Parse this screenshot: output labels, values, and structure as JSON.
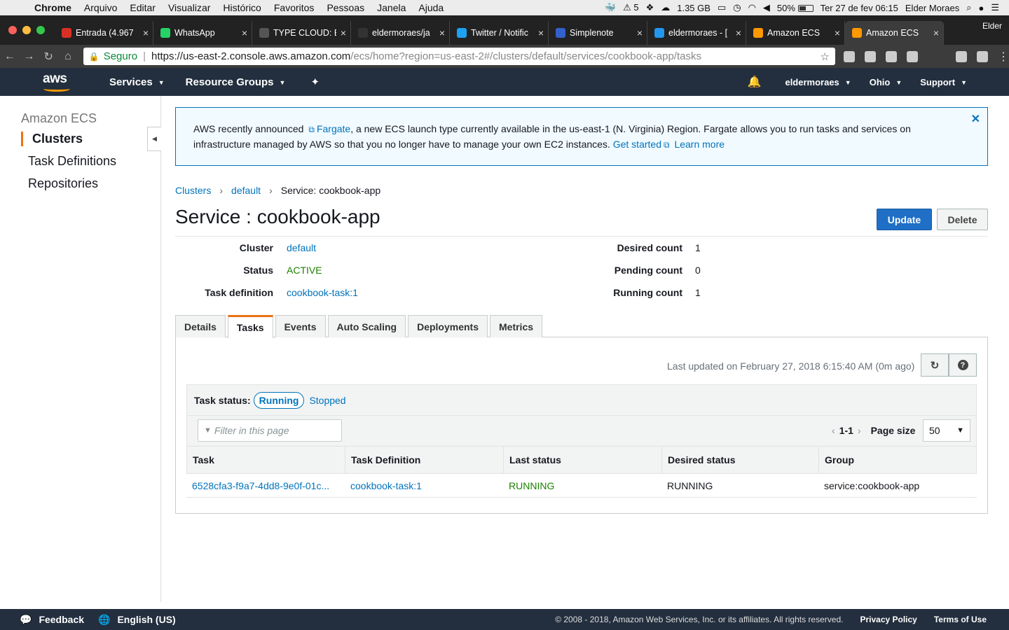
{
  "os_menubar": {
    "app": "Chrome",
    "menus": [
      "Arquivo",
      "Editar",
      "Visualizar",
      "Histórico",
      "Favoritos",
      "Pessoas",
      "Janela",
      "Ajuda"
    ],
    "status_items": [
      "5",
      "1.35 GB",
      "50%"
    ],
    "datetime": "Ter 27 de fev 06:15",
    "user": "Elder Moraes"
  },
  "browser": {
    "tabs": [
      {
        "title": "Entrada (4.967",
        "icon": "gmail-icon",
        "color": "#d93025"
      },
      {
        "title": "WhatsApp",
        "icon": "whatsapp-icon",
        "color": "#25d366"
      },
      {
        "title": "TYPE CLOUD: E",
        "icon": "document-icon",
        "color": "#555555"
      },
      {
        "title": "eldermoraes/ja",
        "icon": "github-icon",
        "color": "#333333"
      },
      {
        "title": "Twitter / Notific",
        "icon": "twitter-icon",
        "color": "#1da1f2"
      },
      {
        "title": "Simplenote",
        "icon": "simplenote-icon",
        "color": "#3361cc"
      },
      {
        "title": "eldermoraes - [",
        "icon": "docker-icon",
        "color": "#2496ed"
      },
      {
        "title": "Amazon ECS",
        "icon": "aws-icon",
        "color": "#ff9900"
      },
      {
        "title": "Amazon ECS",
        "icon": "aws-icon",
        "color": "#ff9900"
      }
    ],
    "profile": "Elder",
    "secure_label": "Seguro",
    "url_host": "https://us-east-2.console.aws.amazon.com",
    "url_path": "/ecs/home?region=us-east-2#/clusters/default/services/cookbook-app/tasks"
  },
  "aws_header": {
    "logo": "aws",
    "services": "Services",
    "resource_groups": "Resource Groups",
    "user": "eldermoraes",
    "region": "Ohio",
    "support": "Support"
  },
  "sidebar": {
    "title": "Amazon ECS",
    "items": [
      "Clusters",
      "Task Definitions",
      "Repositories"
    ]
  },
  "banner": {
    "text1": "AWS recently announced",
    "fargate": "Fargate",
    "text2": ", a new ECS launch type currently available in the us-east-1 (N. Virginia) Region. Fargate allows you to run tasks and services on infrastructure managed by AWS so that you no longer have to manage your own EC2 instances.",
    "get_started": "Get started",
    "learn_more": "Learn more"
  },
  "breadcrumb": {
    "clusters": "Clusters",
    "cluster": "default",
    "current": "Service: cookbook-app"
  },
  "service": {
    "title": "Service : cookbook-app",
    "update": "Update",
    "delete": "Delete",
    "cluster_label": "Cluster",
    "cluster": "default",
    "status_label": "Status",
    "status": "ACTIVE",
    "taskdef_label": "Task definition",
    "taskdef": "cookbook-task:1",
    "desired_label": "Desired count",
    "desired": "1",
    "pending_label": "Pending count",
    "pending": "0",
    "running_label": "Running count",
    "running": "1"
  },
  "tabs": [
    "Details",
    "Tasks",
    "Events",
    "Auto Scaling",
    "Deployments",
    "Metrics"
  ],
  "tasks_panel": {
    "last_updated": "Last updated on February 27, 2018 6:15:40 AM (0m ago)",
    "status_label": "Task status:",
    "running": "Running",
    "stopped": "Stopped",
    "filter_placeholder": "Filter in this page",
    "range": "1-1",
    "page_size_label": "Page size",
    "page_size": "50",
    "columns": [
      "Task",
      "Task Definition",
      "Last status",
      "Desired status",
      "Group"
    ],
    "rows": [
      {
        "task": "6528cfa3-f9a7-4dd8-9e0f-01c...",
        "taskdef": "cookbook-task:1",
        "last": "RUNNING",
        "desired": "RUNNING",
        "group": "service:cookbook-app"
      }
    ]
  },
  "footer": {
    "feedback": "Feedback",
    "language": "English (US)",
    "copyright": "© 2008 - 2018, Amazon Web Services, Inc. or its affiliates. All rights reserved.",
    "privacy": "Privacy Policy",
    "terms": "Terms of Use"
  }
}
